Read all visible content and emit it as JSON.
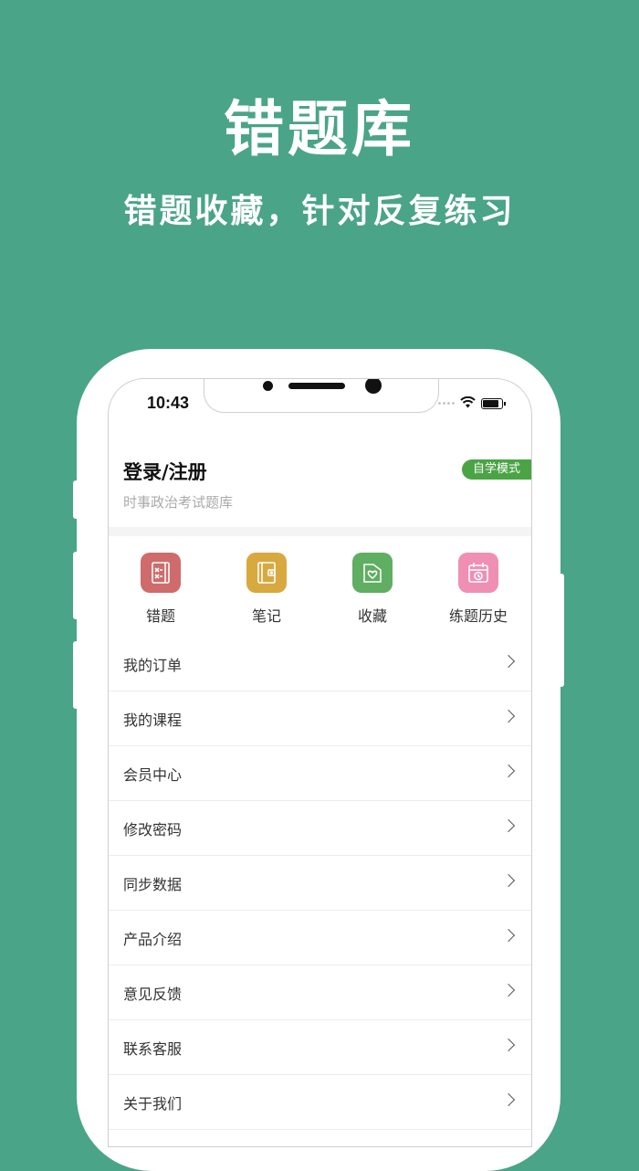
{
  "hero": {
    "title": "错题库",
    "subtitle": "错题收藏，针对反复练习"
  },
  "status_bar": {
    "time": "10:43",
    "icons": [
      "signal-icon",
      "wifi-icon",
      "battery-icon"
    ]
  },
  "profile": {
    "title": "登录/注册",
    "subtitle": "时事政治考试题库",
    "mode_badge": "自学模式"
  },
  "quick_actions": [
    {
      "label": "错题",
      "icon": "wrong-questions-icon",
      "color": "#cf6b6b"
    },
    {
      "label": "笔记",
      "icon": "notebook-icon",
      "color": "#d7a93f"
    },
    {
      "label": "收藏",
      "icon": "favorite-folder-icon",
      "color": "#5fae62"
    },
    {
      "label": "练题历史",
      "icon": "history-calendar-icon",
      "color": "#ef8fb3"
    }
  ],
  "menu": [
    {
      "label": "我的订单"
    },
    {
      "label": "我的课程"
    },
    {
      "label": "会员中心"
    },
    {
      "label": "修改密码"
    },
    {
      "label": "同步数据"
    },
    {
      "label": "产品介绍"
    },
    {
      "label": "意见反馈"
    },
    {
      "label": "联系客服"
    },
    {
      "label": "关于我们"
    }
  ],
  "colors": {
    "background": "#4aa488",
    "badge": "#4aa445"
  }
}
